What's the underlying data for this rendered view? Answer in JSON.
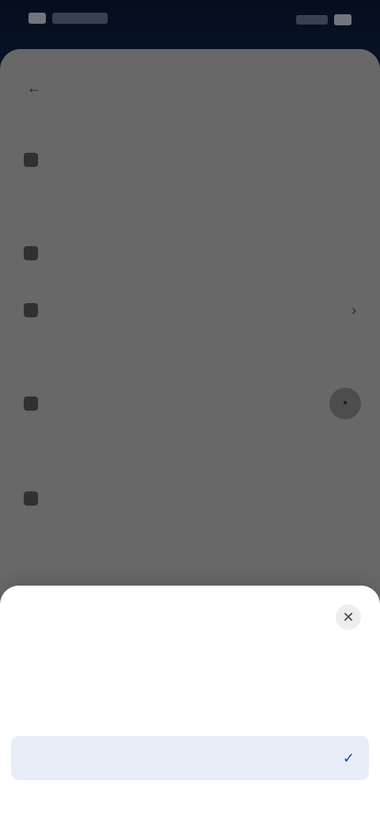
{
  "status_bar": {
    "time": "",
    "icons": [
      "signal-icon",
      "wifi-icon",
      "battery-icon"
    ]
  },
  "settings_screen": {
    "title": "",
    "sections": [
      {
        "label": "",
        "rows": [
          {
            "icon": "settings-icon",
            "text": "",
            "control": "none"
          }
        ]
      },
      {
        "label": "",
        "rows": [
          {
            "icon": "settings-icon",
            "text": "",
            "control": "none"
          },
          {
            "icon": "settings-icon",
            "text": "",
            "control": "chevron"
          }
        ]
      },
      {
        "label": "",
        "rows": [
          {
            "icon": "settings-icon",
            "text": "",
            "control": "round-button"
          }
        ]
      },
      {
        "label": "",
        "rows": [
          {
            "icon": "settings-icon",
            "text": "",
            "control": "none"
          }
        ]
      },
      {
        "label": "",
        "rows": []
      }
    ]
  },
  "bottom_sheet": {
    "title": "",
    "close_icon": "close-icon",
    "options": [
      {
        "label": "",
        "selected": false
      },
      {
        "label": "",
        "selected": false
      },
      {
        "label": "",
        "selected": true
      }
    ]
  },
  "colors": {
    "header_bg": "#0b1a36",
    "sheet_bg": "#ffffff",
    "selected_bg": "#e7eef8",
    "accent": "#1b4f9c"
  }
}
